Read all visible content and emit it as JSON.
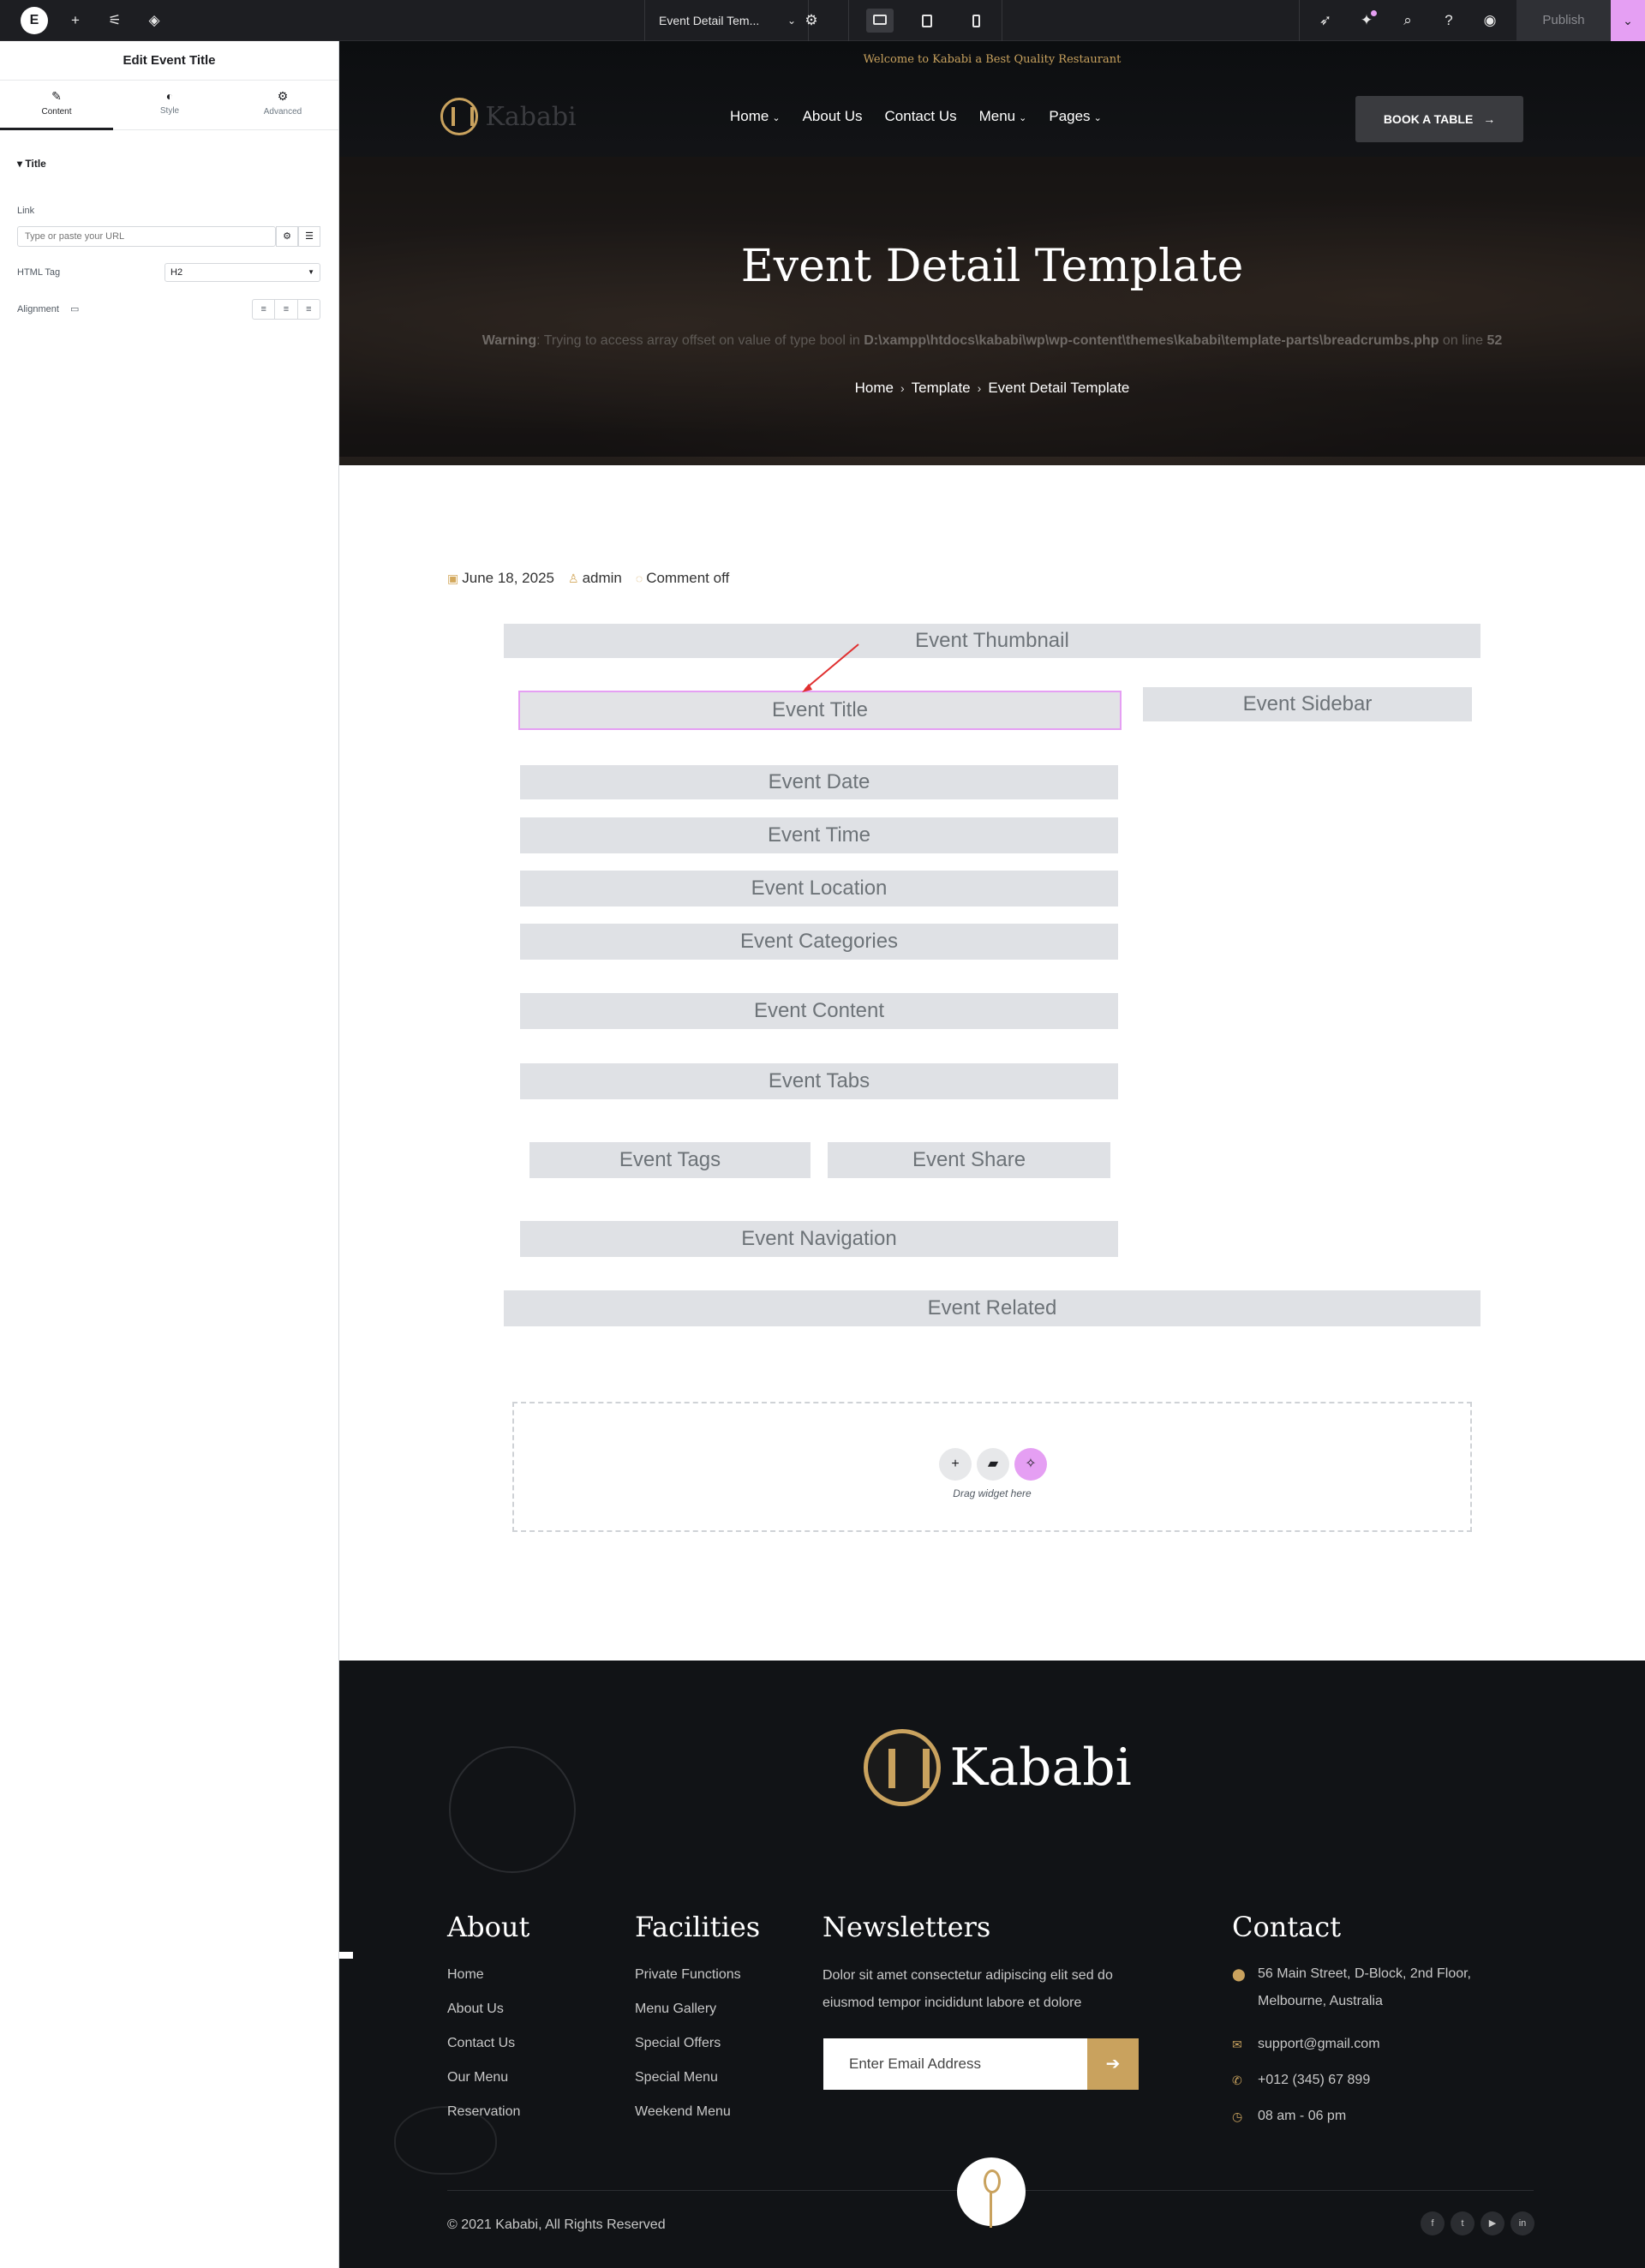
{
  "editor": {
    "logo": "E",
    "document_name": "Event Detail Tem...",
    "publish_label": "Publish",
    "icons": [
      "plus-icon",
      "sliders-icon",
      "layers-icon",
      "gear-icon",
      "rocket-icon",
      "ai-icon",
      "search-icon",
      "help-icon",
      "eye-icon"
    ],
    "accent": "#e59ff3"
  },
  "panel": {
    "title": "Edit Event Title",
    "tabs": [
      {
        "label": "Content",
        "icon": "pencil-icon"
      },
      {
        "label": "Style",
        "icon": "half-circle-icon"
      },
      {
        "label": "Advanced",
        "icon": "gear-icon"
      }
    ],
    "section": "Title",
    "link_label": "Link",
    "link_placeholder": "Type or paste your URL",
    "html_tag_label": "HTML Tag",
    "html_tag_value": "H2",
    "alignment_label": "Alignment"
  },
  "site": {
    "welcome": "Welcome to Kababi a Best Quality Restaurant",
    "logo_text": "Kababi",
    "nav": [
      "Home",
      "About Us",
      "Contact Us",
      "Menu",
      "Pages"
    ],
    "book_button": "BOOK A TABLE",
    "hero_title": "Event Detail Template",
    "warning_prefix": "Warning",
    "warning_text": ": Trying to access array offset on value of type bool in ",
    "warning_path": "D:\\xampp\\htdocs\\kababi\\wp\\wp-content\\themes\\kababi\\template-parts\\breadcrumbs.php",
    "warning_line_label": " on line ",
    "warning_line": "52",
    "breadcrumb": [
      "Home",
      "Template",
      "Event Detail Template"
    ],
    "gold": "#c9a25e"
  },
  "post_meta": {
    "date": "June 18, 2025",
    "author": "admin",
    "comments": "Comment off"
  },
  "widgets": {
    "thumbnail": "Event Thumbnail",
    "title": "Event Title",
    "sidebar": "Event Sidebar",
    "date": "Event Date",
    "time": "Event Time",
    "location": "Event Location",
    "categories": "Event Categories",
    "content": "Event Content",
    "tabs": "Event Tabs",
    "tags": "Event Tags",
    "share": "Event Share",
    "navigation": "Event Navigation",
    "related": "Event Related"
  },
  "dropzone": {
    "text": "Drag widget here"
  },
  "footer": {
    "logo_text": "Kababi",
    "about_title": "About",
    "about_links": [
      "Home",
      "About Us",
      "Contact Us",
      "Our Menu",
      "Reservation"
    ],
    "facilities_title": "Facilities",
    "facilities_links": [
      "Private Functions",
      "Menu Gallery",
      "Special Offers",
      "Special Menu",
      "Weekend Menu"
    ],
    "newsletter_title": "Newsletters",
    "newsletter_text": "Dolor sit amet consectetur adipiscing elit sed do eiusmod tempor incididunt labore et dolore",
    "email_placeholder": "Enter Email Address",
    "contact_title": "Contact",
    "address": "56 Main Street, D-Block, 2nd Floor, Melbourne, Australia",
    "email": "support@gmail.com",
    "phone": "+012 (345) 67 899",
    "hours": "08 am - 06 pm",
    "copyright": "© 2021 Kababi, All Rights Reserved",
    "social": [
      "facebook-icon",
      "twitter-icon",
      "youtube-icon",
      "linkedin-icon"
    ]
  }
}
